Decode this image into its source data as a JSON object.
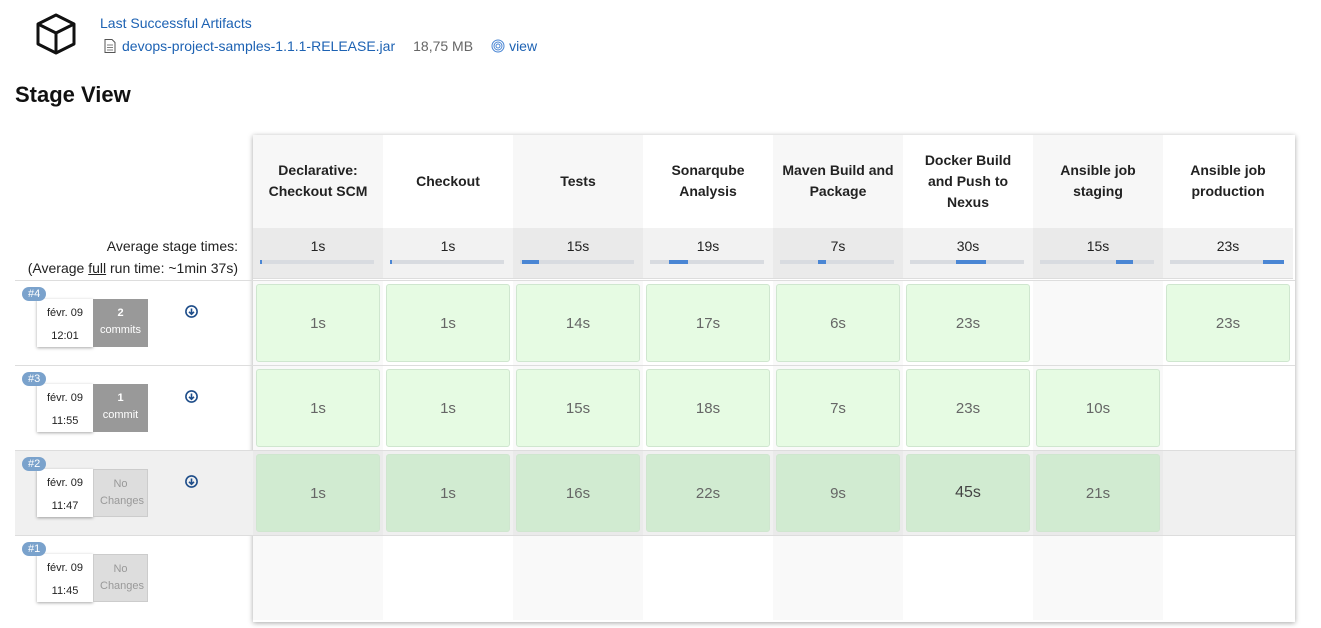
{
  "artifacts": {
    "title": "Last Successful Artifacts",
    "file_name": "devops-project-samples-1.1.1-RELEASE.jar",
    "file_size": "18,75 MB",
    "view_label": "view"
  },
  "page_title": "Stage View",
  "avg": {
    "line1": "Average stage times:",
    "line2_prefix": "(Average ",
    "line2_link": "full",
    "line2_suffix": " run time: ~1min 37s)"
  },
  "stages": [
    {
      "name": "Declarative: Checkout SCM",
      "avg": "1s",
      "bar_start": 0.0,
      "bar_end": 0.02
    },
    {
      "name": "Checkout",
      "avg": "1s",
      "bar_start": 0.0,
      "bar_end": 0.02
    },
    {
      "name": "Tests",
      "avg": "15s",
      "bar_start": 0.02,
      "bar_end": 0.17
    },
    {
      "name": "Sonarqube Analysis",
      "avg": "19s",
      "bar_start": 0.17,
      "bar_end": 0.33
    },
    {
      "name": "Maven Build and Package",
      "avg": "7s",
      "bar_start": 0.33,
      "bar_end": 0.4
    },
    {
      "name": "Docker Build and Push to Nexus",
      "avg": "30s",
      "bar_start": 0.4,
      "bar_end": 0.67
    },
    {
      "name": "Ansible job staging",
      "avg": "15s",
      "bar_start": 0.67,
      "bar_end": 0.82
    },
    {
      "name": "Ansible job production",
      "avg": "23s",
      "bar_start": 0.82,
      "bar_end": 1.0
    }
  ],
  "builds": [
    {
      "number": "#4",
      "date": "févr. 09",
      "time": "12:01",
      "commits_count": "2",
      "commits_label": "commits",
      "cells": [
        "1s",
        "1s",
        "14s",
        "17s",
        "6s",
        "23s",
        null,
        "23s"
      ]
    },
    {
      "number": "#3",
      "date": "févr. 09",
      "time": "11:55",
      "commits_count": "1",
      "commits_label": "commit",
      "cells": [
        "1s",
        "1s",
        "15s",
        "18s",
        "7s",
        "23s",
        "10s",
        null
      ]
    },
    {
      "number": "#2",
      "date": "févr. 09",
      "time": "11:47",
      "commits_count": "",
      "commits_label": "No Changes",
      "cells": [
        "1s",
        "1s",
        "16s",
        "22s",
        "9s",
        "45s",
        "21s",
        null
      ]
    },
    {
      "number": "#1",
      "date": "févr. 09",
      "time": "11:45",
      "commits_count": "",
      "commits_label": "No Changes",
      "cells": [
        null,
        null,
        null,
        null,
        null,
        null,
        null,
        null
      ]
    }
  ],
  "colors": {
    "link": "#1d62b3",
    "success_light": "#e6fbe3",
    "success_dark": "#c8e6c8",
    "avg_bar": "#4a86d4",
    "badge": "#7aa2cc"
  },
  "icons": {
    "artifact": "box-icon",
    "file": "file-icon",
    "view": "fingerprint-icon",
    "changes": "arrow-down-circle-icon"
  }
}
